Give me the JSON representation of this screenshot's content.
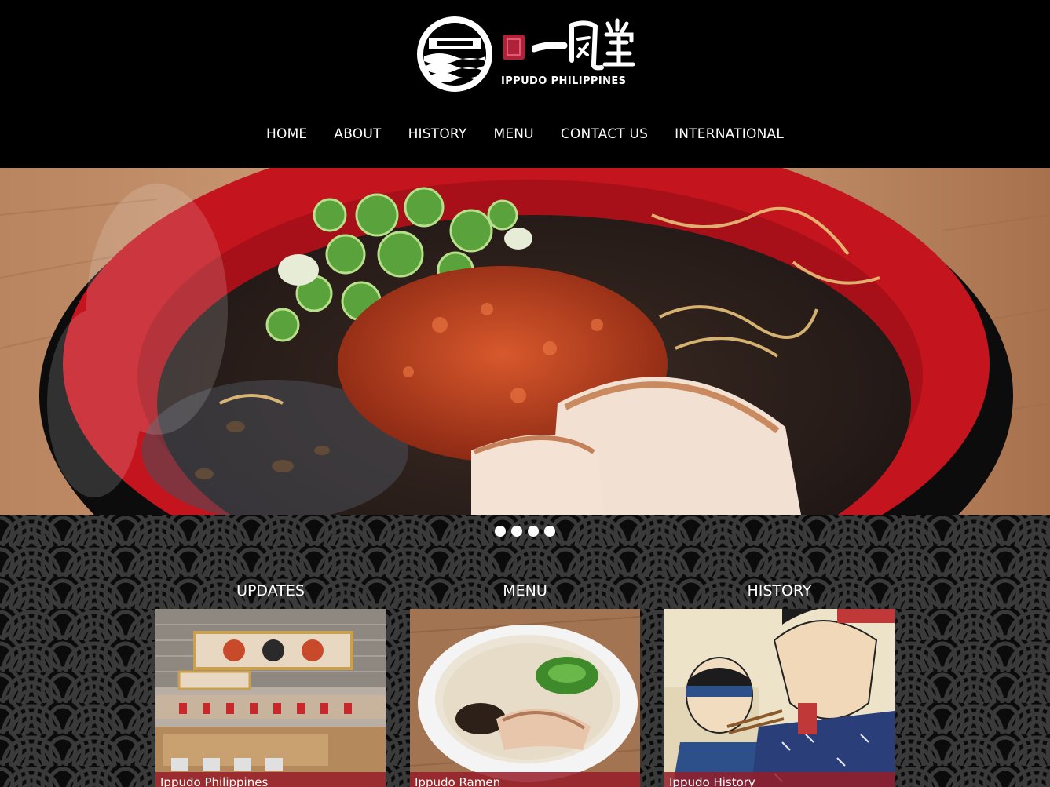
{
  "brand": {
    "logo_text": "IPPUDO PHILIPPINES",
    "colors": {
      "background": "#000000",
      "accent": "#b0213a",
      "text": "#ffffff"
    }
  },
  "nav": {
    "items": [
      {
        "label": "HOME"
      },
      {
        "label": "ABOUT"
      },
      {
        "label": "HISTORY"
      },
      {
        "label": "MENU"
      },
      {
        "label": "CONTACT US"
      },
      {
        "label": "INTERNATIONAL"
      }
    ]
  },
  "hero": {
    "image": "ramen-bowl-photo",
    "slide_count": 4
  },
  "cards": [
    {
      "title": "UPDATES",
      "caption": "Ippudo Philippines",
      "image": "restaurant-interior-photo"
    },
    {
      "title": "MENU",
      "caption": "Ippudo Ramen",
      "image": "ramen-bowl-photo"
    },
    {
      "title": "HISTORY",
      "caption": "Ippudo History",
      "image": "ukiyo-e-illustration"
    }
  ]
}
